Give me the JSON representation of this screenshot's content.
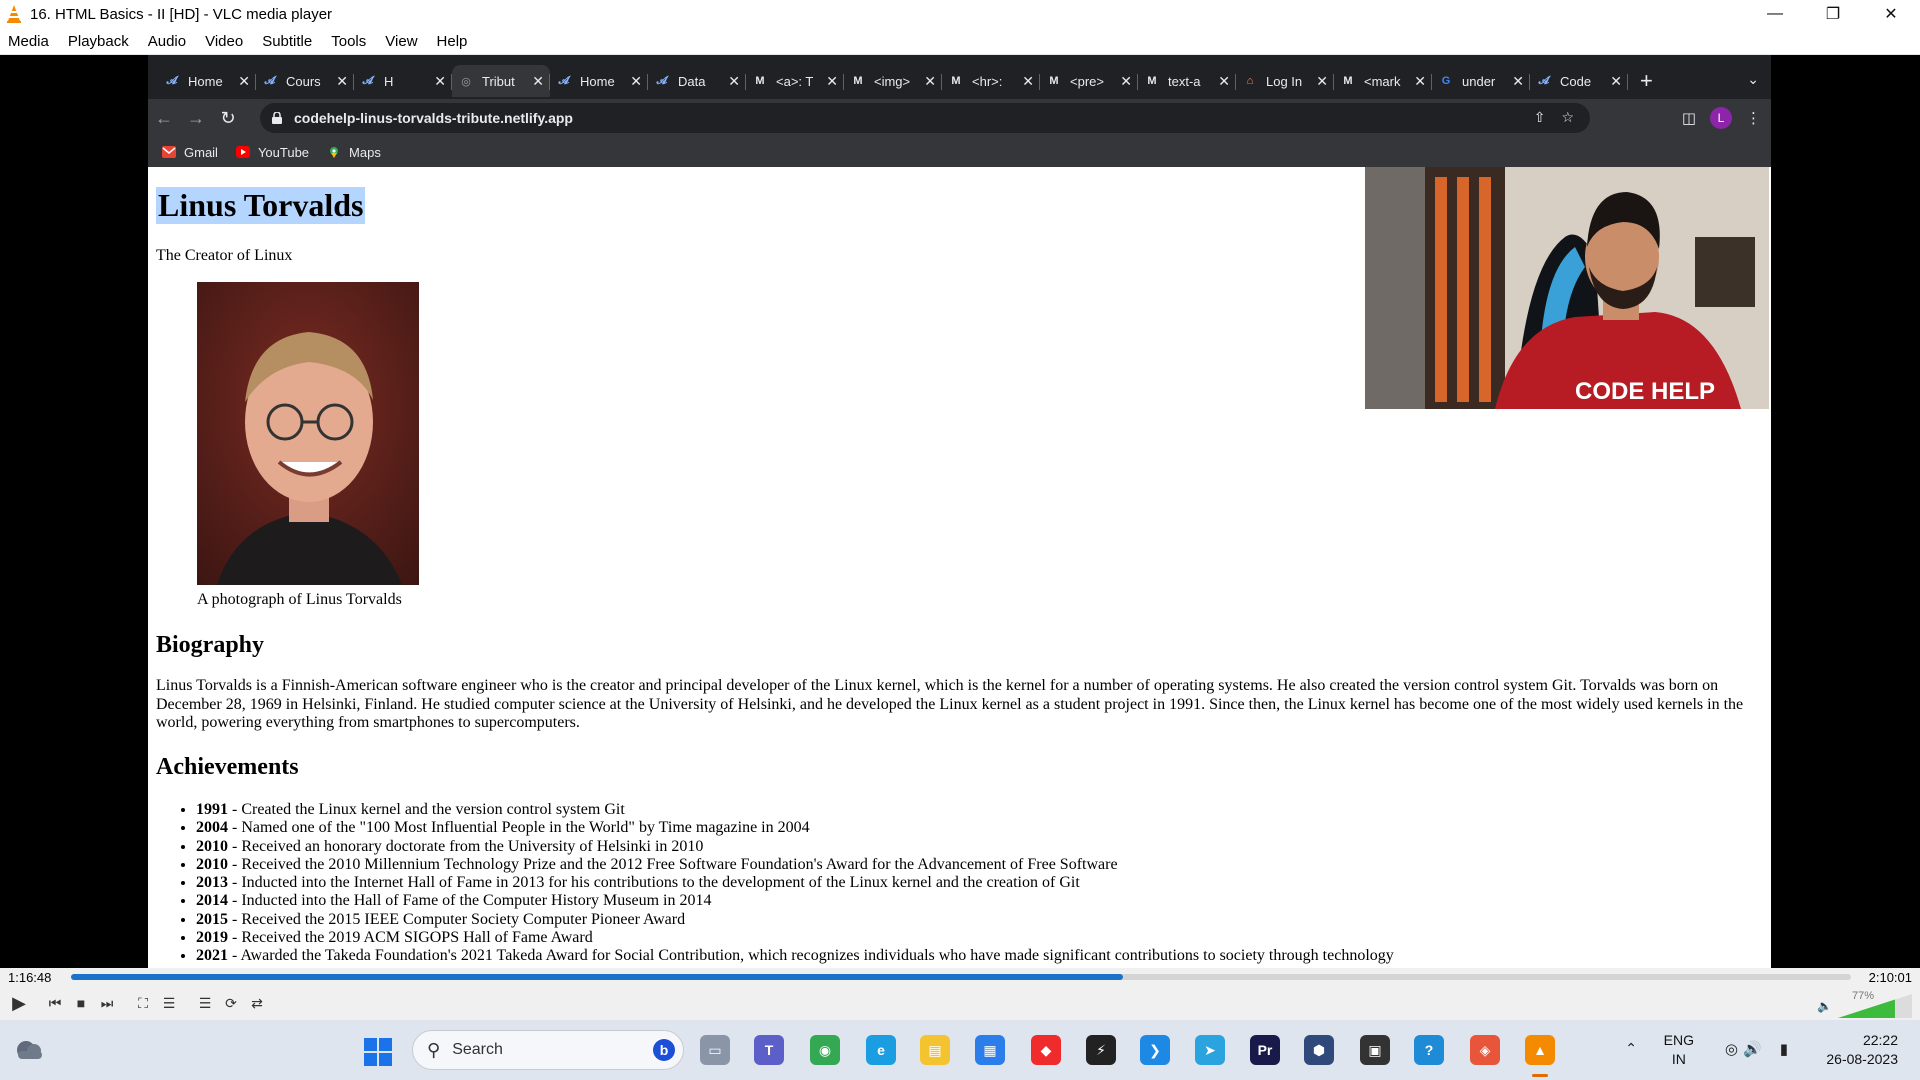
{
  "vlc": {
    "window_title": "16. HTML Basics - II [HD] - VLC media player",
    "menu": [
      "Media",
      "Playback",
      "Audio",
      "Video",
      "Subtitle",
      "Tools",
      "View",
      "Help"
    ],
    "elapsed": "1:16:48",
    "total": "2:10:01",
    "progress": 0.591,
    "volume_pct": "77%",
    "volume_level": 0.77
  },
  "browser": {
    "tabs": [
      {
        "label": "Home",
        "icon": "codehelp-icon"
      },
      {
        "label": "Cours",
        "icon": "codehelp-icon"
      },
      {
        "label": "H",
        "icon": "codehelp-icon"
      },
      {
        "label": "Tribut",
        "icon": "globe-icon",
        "active": true
      },
      {
        "label": "Home",
        "icon": "codehelp-icon"
      },
      {
        "label": "Data",
        "icon": "codehelp-icon"
      },
      {
        "label": "<a>: T",
        "icon": "mdn-icon"
      },
      {
        "label": "<img>",
        "icon": "mdn-icon"
      },
      {
        "label": "<hr>:",
        "icon": "mdn-icon"
      },
      {
        "label": "<pre>",
        "icon": "mdn-icon"
      },
      {
        "label": "text-a",
        "icon": "mdn-icon"
      },
      {
        "label": "Log In",
        "icon": "login-icon"
      },
      {
        "label": "<mark",
        "icon": "mdn-icon"
      },
      {
        "label": "under",
        "icon": "google-icon"
      },
      {
        "label": "Code",
        "icon": "codehelp-icon"
      }
    ],
    "url": "codehelp-linus-torvalds-tribute.netlify.app",
    "profile_initial": "L",
    "bookmarks": [
      "Gmail",
      "YouTube",
      "Maps"
    ]
  },
  "page": {
    "title": "Linus Torvalds",
    "subtitle": "The Creator of Linux",
    "caption": "A photograph of Linus Torvalds",
    "bio_heading": "Biography",
    "bio_text": "Linus Torvalds is a Finnish-American software engineer who is the creator and principal developer of the Linux kernel, which is the kernel for a number of operating systems. He also created the version control system Git. Torvalds was born on December 28, 1969 in Helsinki, Finland. He studied computer science at the University of Helsinki, and he developed the Linux kernel as a student project in 1991. Since then, the Linux kernel has become one of the most widely used kernels in the world, powering everything from smartphones to supercomputers.",
    "achievements_heading": "Achievements",
    "achievements": [
      {
        "year": "1991",
        "text": " - Created the Linux kernel and the version control system Git"
      },
      {
        "year": "2004",
        "text": " - Named one of the \"100 Most Influential People in the World\" by Time magazine in 2004"
      },
      {
        "year": "2010",
        "text": " - Received an honorary doctorate from the University of Helsinki in 2010"
      },
      {
        "year": "2010",
        "text": " - Received the 2010 Millennium Technology Prize and the 2012 Free Software Foundation's Award for the Advancement of Free Software"
      },
      {
        "year": "2013",
        "text": " - Inducted into the Internet Hall of Fame in 2013 for his contributions to the development of the Linux kernel and the creation of Git"
      },
      {
        "year": "2014",
        "text": " - Inducted into the Hall of Fame of the Computer History Museum in 2014"
      },
      {
        "year": "2015",
        "text": " - Received the 2015 IEEE Computer Society Computer Pioneer Award"
      },
      {
        "year": "2019",
        "text": " - Received the 2019 ACM SIGOPS Hall of Fame Award"
      },
      {
        "year": "2021",
        "text": " - Awarded the Takeda Foundation's 2021 Takeda Award for Social Contribution, which recognizes individuals who have made significant contributions to society through technology"
      }
    ],
    "webcam_shirt_text": "CODE HELP"
  },
  "taskbar": {
    "search_label": "Search",
    "lang_top": "ENG",
    "lang_bottom": "IN",
    "time": "22:22",
    "date": "26-08-2023",
    "apps": [
      "desktop-icon",
      "teams-icon",
      "chrome-icon",
      "edge-icon",
      "explorer-icon",
      "store-icon",
      "anydesk-icon",
      "cursor-icon",
      "vscode-icon",
      "telegram-icon",
      "premiere-icon",
      "virtualbox-icon",
      "app-icon",
      "help-icon",
      "git-icon",
      "vlc-icon"
    ]
  }
}
